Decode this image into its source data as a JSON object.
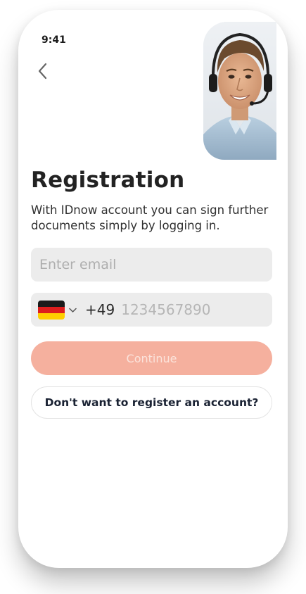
{
  "status_bar": {
    "time": "9:41"
  },
  "nav": {
    "back_icon": "chevron-left-icon"
  },
  "header": {
    "photo": "support-agent-with-headset-photo",
    "title": "Registration",
    "subtitle": "With IDnow account you can sign further documents simply by logging in."
  },
  "form": {
    "email_placeholder": "Enter email",
    "email_value": "",
    "country_flag": "germany-flag-icon",
    "dial_code": "+49",
    "phone_placeholder": "1234567890",
    "phone_value": ""
  },
  "actions": {
    "continue_label": "Continue",
    "skip_label": "Don't want to register an account?"
  },
  "colors": {
    "accent_disabled": "#f5b09e",
    "field_bg": "#ececec",
    "text_dark": "#222222"
  }
}
